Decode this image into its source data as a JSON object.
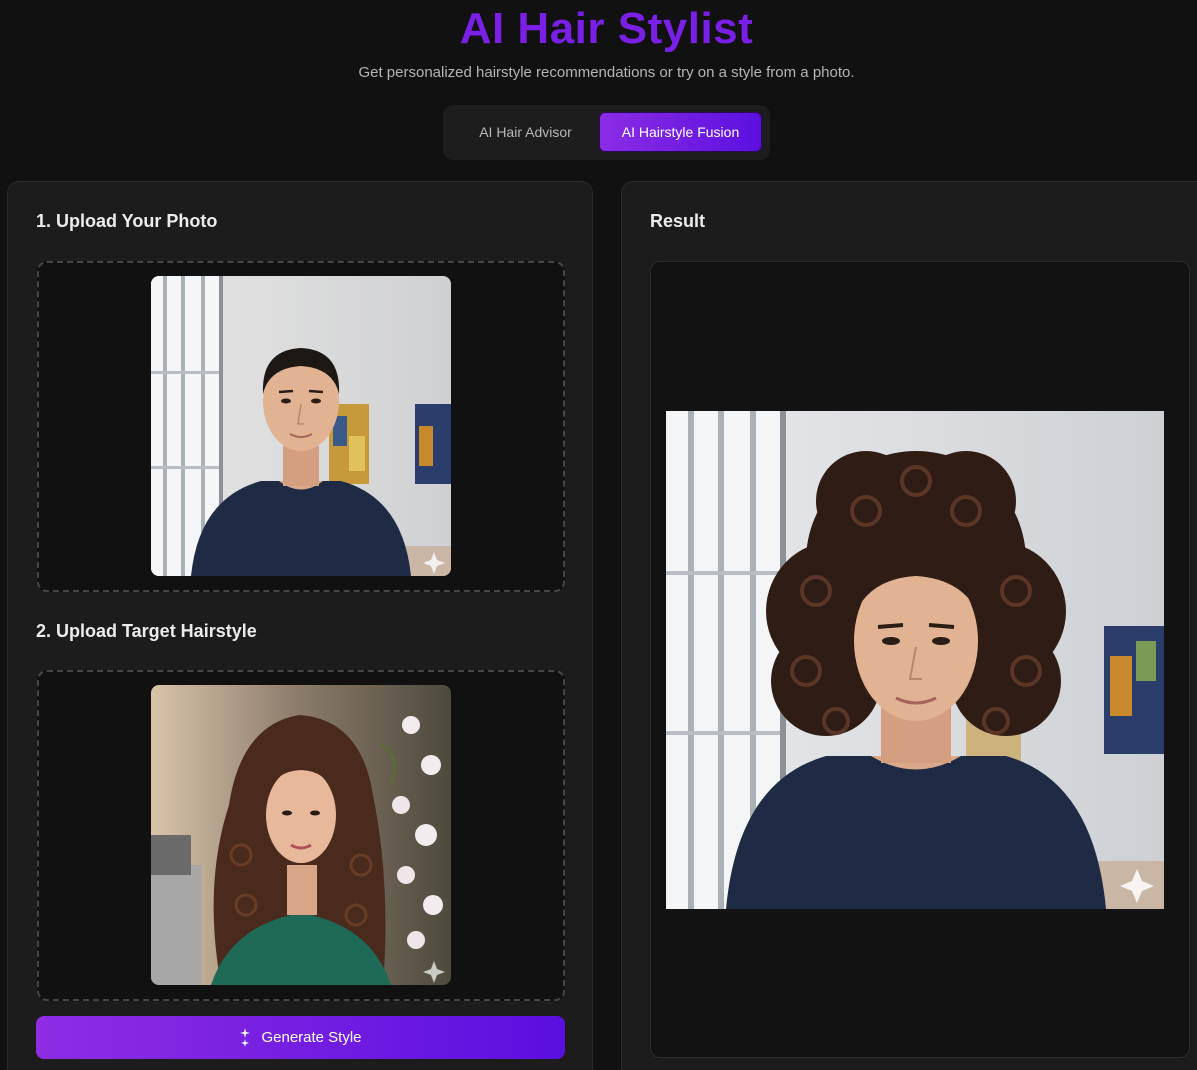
{
  "header": {
    "title": "AI Hair Stylist",
    "subtitle": "Get personalized hairstyle recommendations or try on a style from a photo."
  },
  "tabs": [
    {
      "label": "AI Hair Advisor",
      "active": false
    },
    {
      "label": "AI Hairstyle Fusion",
      "active": true
    }
  ],
  "left_panel": {
    "step1_label": "1. Upload Your Photo",
    "step2_label": "2. Upload Target Hairstyle",
    "generate_label": "Generate Style"
  },
  "right_panel": {
    "result_label": "Result"
  },
  "colors": {
    "accent_start": "#8e2de2",
    "accent_end": "#5a0fe0",
    "title": "#7a1fe6"
  }
}
